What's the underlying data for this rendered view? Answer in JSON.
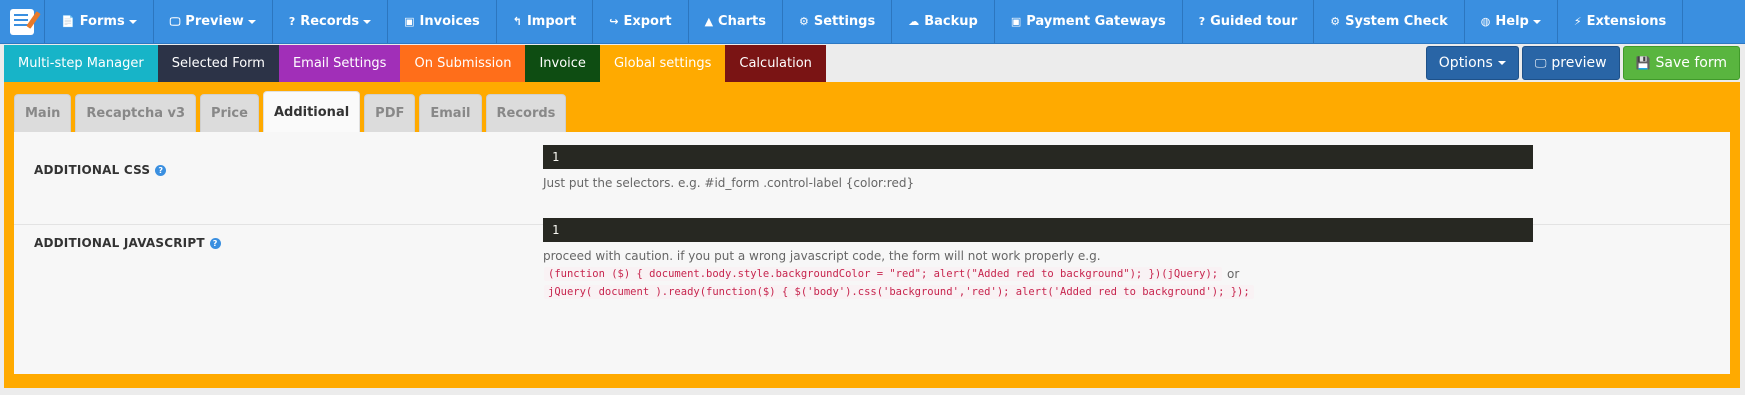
{
  "topnav": {
    "items": [
      {
        "label": "Forms",
        "icon": "document-icon",
        "dropdown": true
      },
      {
        "label": "Preview",
        "icon": "monitor-icon",
        "dropdown": true
      },
      {
        "label": "Records",
        "icon": "question-circle-icon",
        "dropdown": true
      },
      {
        "label": "Invoices",
        "icon": "money-icon",
        "dropdown": false
      },
      {
        "label": "Import",
        "icon": "reply-icon",
        "dropdown": false
      },
      {
        "label": "Export",
        "icon": "share-icon",
        "dropdown": false
      },
      {
        "label": "Charts",
        "icon": "area-chart-icon",
        "dropdown": false
      },
      {
        "label": "Settings",
        "icon": "gear-icon",
        "dropdown": false
      },
      {
        "label": "Backup",
        "icon": "cloud-icon",
        "dropdown": false
      },
      {
        "label": "Payment Gateways",
        "icon": "money-icon",
        "dropdown": false
      },
      {
        "label": "Guided tour",
        "icon": "question-circle-icon",
        "dropdown": false
      },
      {
        "label": "System Check",
        "icon": "gear-icon",
        "dropdown": false
      },
      {
        "label": "Help",
        "icon": "globe-icon",
        "dropdown": true
      },
      {
        "label": "Extensions",
        "icon": "plug-icon",
        "dropdown": false
      }
    ]
  },
  "secnav": {
    "items": [
      {
        "label": "Multi-step Manager",
        "color": "#17b4c8"
      },
      {
        "label": "Selected Form",
        "color": "#2c3347"
      },
      {
        "label": "Email Settings",
        "color": "#a12fb8"
      },
      {
        "label": "On Submission",
        "color": "#ff6e1a"
      },
      {
        "label": "Invoice",
        "color": "#0e4d12"
      },
      {
        "label": "Global settings",
        "color": "#ffaa00"
      },
      {
        "label": "Calculation",
        "color": "#7a1414"
      }
    ]
  },
  "actions": {
    "options": "Options",
    "preview": "preview",
    "save": "Save form"
  },
  "tabs": [
    "Main",
    "Recaptcha v3",
    "Price",
    "Additional",
    "PDF",
    "Email",
    "Records"
  ],
  "active_tab": "Additional",
  "additional": {
    "css_label": "ADDITIONAL CSS",
    "css_line": "1",
    "css_hint": "Just put the selectors. e.g. #id_form .control-label {color:red}",
    "js_label": "ADDITIONAL JAVASCRIPT",
    "js_line": "1",
    "js_hint": "proceed with caution. if you put a wrong javascript code, the form will not work properly e.g.",
    "js_example1": "(function ($) { document.body.style.backgroundColor = \"red\"; alert(\"Added red to background\"); })(jQuery);",
    "or_text": "or",
    "js_example2": "jQuery( document ).ready(function($) { $('body').css('background','red'); alert('Added red to background'); });"
  }
}
